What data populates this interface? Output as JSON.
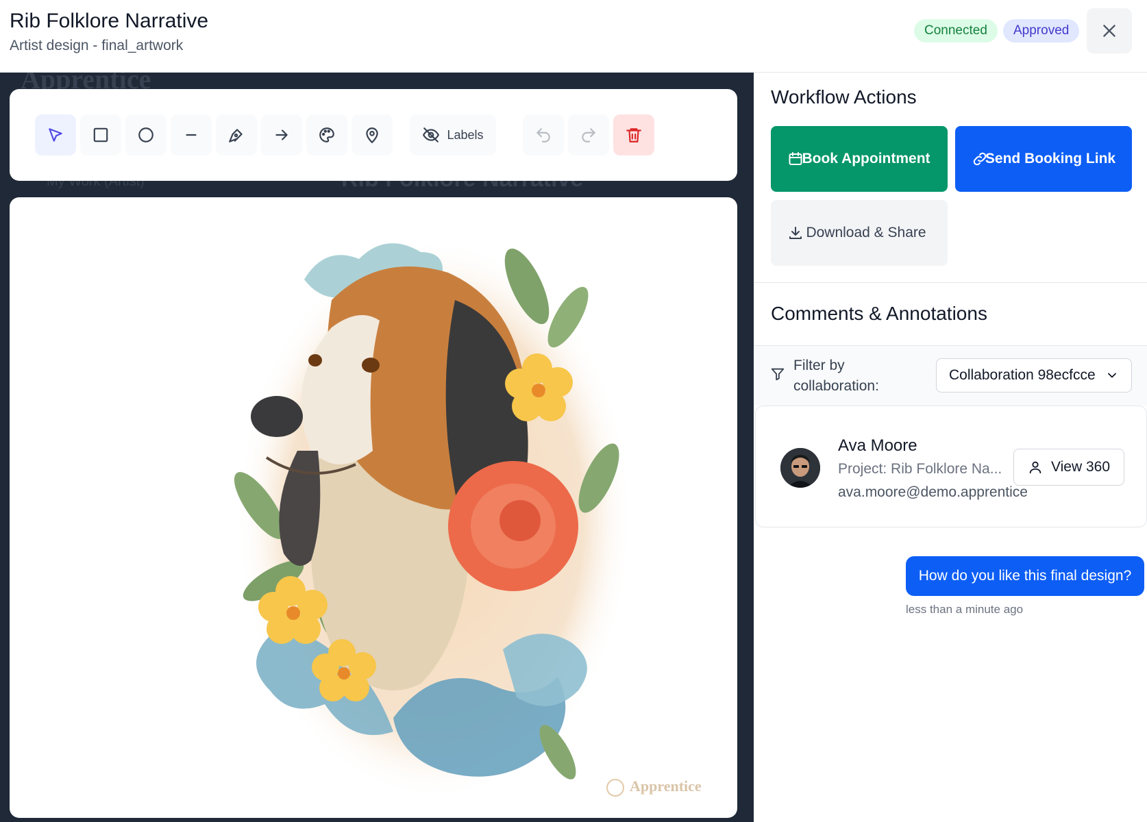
{
  "header": {
    "title": "Rib Folklore Narrative",
    "subtitle": "Artist design - final_artwork",
    "badges": {
      "connected": "Connected",
      "approved": "Approved"
    }
  },
  "toolbar": {
    "tools": [
      "select-icon",
      "rectangle-icon",
      "circle-icon",
      "line-icon",
      "pen-icon",
      "arrow-icon",
      "palette-icon",
      "pin-icon"
    ],
    "labels_toggle": "Labels",
    "undo": "undo-icon",
    "redo": "redo-icon",
    "delete": "trash-icon"
  },
  "artwork": {
    "watermark": "Apprentice",
    "background_text": {
      "logo": "Apprentice",
      "nav_item": "My Work (Artist)",
      "heading": "Rib Folklore Narrative"
    }
  },
  "workflow": {
    "title": "Workflow Actions",
    "book_label": "Book Appointment",
    "send_label": "Send Booking Link",
    "download_label": "Download & Share"
  },
  "comments": {
    "title": "Comments & Annotations",
    "filter_label": "Filter by collaboration:",
    "filter_value": "Collaboration 98ecfcce",
    "user": {
      "name": "Ava Moore",
      "project": "Project: Rib Folklore Na...",
      "email": "ava.moore@demo.apprentice",
      "view_label": "View 360"
    },
    "messages": [
      {
        "text": "How do you like this final design?",
        "time": "less than a minute ago"
      }
    ]
  },
  "colors": {
    "primary_blue": "#0d5ef5",
    "green": "#059669",
    "canvas_bg": "#1f2937",
    "connected_bg": "#dcfce7",
    "approved_bg": "#e0e7ff"
  }
}
